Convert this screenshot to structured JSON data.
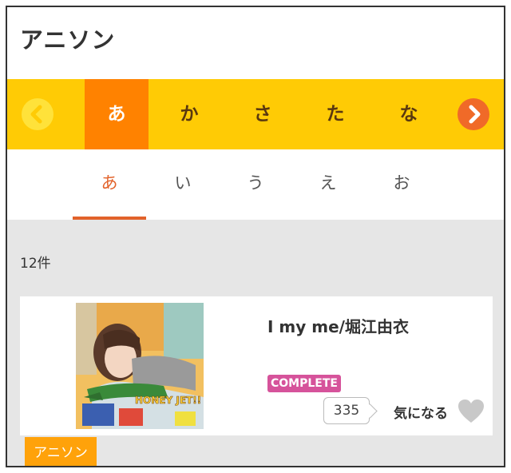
{
  "page": {
    "title": "アニソン"
  },
  "kana_rows": {
    "items": [
      {
        "label": "あ",
        "active": true
      },
      {
        "label": "か",
        "active": false
      },
      {
        "label": "さ",
        "active": false
      },
      {
        "label": "た",
        "active": false
      },
      {
        "label": "な",
        "active": false
      }
    ],
    "prev_icon": "chevron-left-icon",
    "next_icon": "chevron-right-icon"
  },
  "sub_kana": {
    "items": [
      {
        "label": "あ",
        "active": true
      },
      {
        "label": "い",
        "active": false
      },
      {
        "label": "う",
        "active": false
      },
      {
        "label": "え",
        "active": false
      },
      {
        "label": "お",
        "active": false
      }
    ]
  },
  "results": {
    "count_label": "12件"
  },
  "songs": [
    {
      "title": "I my me/堀江由衣",
      "badge": "COMPLETE",
      "favorite_count": "335",
      "favorite_label": "気になる",
      "genre": "アニソン",
      "jacket_text": "HONEY JET!!"
    }
  ],
  "colors": {
    "accent_orange": "#ff8200",
    "bar_yellow": "#ffcb05",
    "active_red": "#e2622a",
    "badge_pink": "#d6539b",
    "genre_orange": "#ffa20a"
  }
}
